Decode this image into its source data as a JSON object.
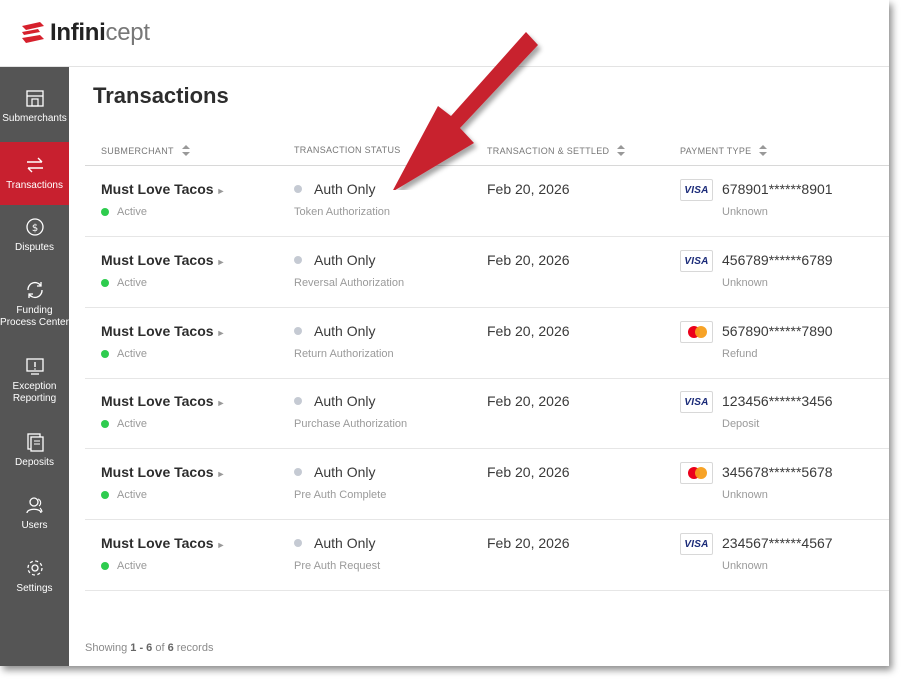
{
  "brand": {
    "name_part1": "Infini",
    "name_part2": "cept",
    "accent": "#c8202f"
  },
  "sidebar": {
    "items": [
      {
        "label": "Submerchants",
        "icon": "storefront-icon",
        "active": false
      },
      {
        "label": "Transactions",
        "icon": "transfer-arrows-icon",
        "active": true
      },
      {
        "label": "Disputes",
        "icon": "dollar-circle-icon",
        "active": false
      },
      {
        "label": "Funding Process Center",
        "icon": "refresh-icon",
        "active": false
      },
      {
        "label": "Exception Reporting",
        "icon": "alert-monitor-icon",
        "active": false
      },
      {
        "label": "Deposits",
        "icon": "documents-icon",
        "active": false
      },
      {
        "label": "Users",
        "icon": "users-icon",
        "active": false
      },
      {
        "label": "Settings",
        "icon": "gear-icon",
        "active": false
      }
    ]
  },
  "page": {
    "title": "Transactions"
  },
  "table": {
    "columns": [
      {
        "label": "SUBMERCHANT",
        "sortable": true
      },
      {
        "label": "TRANSACTION STATUS",
        "sortable": false
      },
      {
        "label": "TRANSACTION & SETTLED",
        "sortable": true
      },
      {
        "label": "PAYMENT TYPE",
        "sortable": true
      }
    ],
    "rows": [
      {
        "merchant": "Must Love Tacos",
        "merchant_status": "Active",
        "status": "Auth Only",
        "status_detail": "Token Authorization",
        "date": "Feb 20, 2026",
        "card_brand": "visa",
        "card_number": "678901******8901",
        "card_note": "Unknown"
      },
      {
        "merchant": "Must Love Tacos",
        "merchant_status": "Active",
        "status": "Auth Only",
        "status_detail": "Reversal Authorization",
        "date": "Feb 20, 2026",
        "card_brand": "visa",
        "card_number": "456789******6789",
        "card_note": "Unknown"
      },
      {
        "merchant": "Must Love Tacos",
        "merchant_status": "Active",
        "status": "Auth Only",
        "status_detail": "Return Authorization",
        "date": "Feb 20, 2026",
        "card_brand": "mastercard",
        "card_number": "567890******7890",
        "card_note": "Refund"
      },
      {
        "merchant": "Must Love Tacos",
        "merchant_status": "Active",
        "status": "Auth Only",
        "status_detail": "Purchase Authorization",
        "date": "Feb 20, 2026",
        "card_brand": "visa",
        "card_number": "123456******3456",
        "card_note": "Deposit"
      },
      {
        "merchant": "Must Love Tacos",
        "merchant_status": "Active",
        "status": "Auth Only",
        "status_detail": "Pre Auth Complete",
        "date": "Feb 20, 2026",
        "card_brand": "mastercard",
        "card_number": "345678******5678",
        "card_note": "Unknown"
      },
      {
        "merchant": "Must Love Tacos",
        "merchant_status": "Active",
        "status": "Auth Only",
        "status_detail": "Pre Auth Request",
        "date": "Feb 20, 2026",
        "card_brand": "visa",
        "card_number": "234567******4567",
        "card_note": "Unknown"
      }
    ],
    "visa_label": "VISA"
  },
  "footer": {
    "prefix": "Showing ",
    "range": "1 - 6",
    "of": " of ",
    "total": "6",
    "suffix": " records"
  },
  "annotation": {
    "arrow_color": "#c8202f"
  }
}
